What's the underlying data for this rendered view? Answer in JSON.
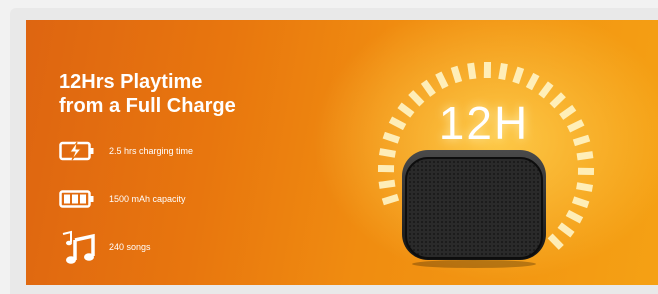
{
  "banner": {
    "title_line1": "12Hrs Playtime",
    "title_line2": "from a Full Charge",
    "badge": "12H",
    "features": [
      {
        "icon": "charging-battery-icon",
        "text": "2.5 hrs charging time"
      },
      {
        "icon": "battery-icon",
        "text": "1500 mAh capacity"
      },
      {
        "icon": "music-notes-icon",
        "text": "240 songs"
      }
    ]
  },
  "colors": {
    "orange_dark": "#de6511",
    "orange_light": "#f5a114",
    "text": "#ffffff",
    "speaker": "#1f1f1f"
  }
}
